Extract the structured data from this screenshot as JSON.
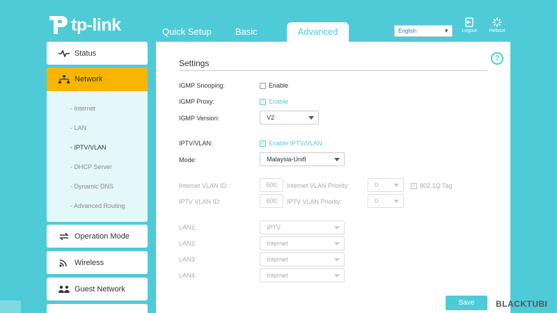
{
  "header": {
    "logo_text": "tp-link",
    "tabs": [
      {
        "label": "Quick Setup"
      },
      {
        "label": "Basic"
      },
      {
        "label": "Advanced",
        "active": true
      }
    ],
    "language": {
      "selected": "English"
    },
    "logout_label": "Logout",
    "reboot_label": "Reboot"
  },
  "sidebar": {
    "items": [
      {
        "label": "Status",
        "icon": "status-pulse-icon"
      },
      {
        "label": "Network",
        "icon": "network-icon",
        "active": true
      },
      {
        "label": "Operation Mode",
        "icon": "operation-mode-icon"
      },
      {
        "label": "Wireless",
        "icon": "wireless-icon"
      },
      {
        "label": "Guest Network",
        "icon": "guest-network-icon"
      }
    ],
    "subitems": [
      {
        "label": "- Internet"
      },
      {
        "label": "- LAN"
      },
      {
        "label": "- IPTV/VLAN",
        "active": true
      },
      {
        "label": "- DHCP Server"
      },
      {
        "label": "- Dynamic DNS"
      },
      {
        "label": "- Advanced Routing"
      }
    ]
  },
  "main": {
    "title": "Settings",
    "help": "?",
    "igmp_snooping": {
      "label": "IGMP Snooping:",
      "checkbox": "Enable",
      "checked": false
    },
    "igmp_proxy": {
      "label": "IGMP Proxy:",
      "checkbox": "Enable",
      "checked": true
    },
    "igmp_version": {
      "label": "IGMP Version:",
      "value": "V2"
    },
    "iptv_vlan": {
      "label": "IPTV/VLAN:",
      "checkbox": "Enable IPTV/VLAN",
      "checked": true
    },
    "mode": {
      "label": "Mode:",
      "value": "Malaysia-Unifi"
    },
    "internet_vlan_id": {
      "label": "Internet VLAN ID:",
      "value": "500"
    },
    "internet_vlan_priority": {
      "label": "Internet VLAN Priority:",
      "value": "0"
    },
    "tag_8021q": {
      "label": "802.1Q Tag",
      "checked": true
    },
    "iptv_vlan_id": {
      "label": "IPTV VLAN ID:",
      "value": "600"
    },
    "iptv_vlan_priority": {
      "label": "IPTV VLAN Priority:",
      "value": "0"
    },
    "lans": [
      {
        "label": "LAN1:",
        "value": "IPTV"
      },
      {
        "label": "LAN2:",
        "value": "Internet"
      },
      {
        "label": "LAN3:",
        "value": "Internet"
      },
      {
        "label": "LAN4:",
        "value": "Internet"
      }
    ],
    "save_label": "Save"
  },
  "watermark": "BLACKTUBI",
  "colors": {
    "accent": "#4ecbd7",
    "active_nav": "#f7b500"
  }
}
